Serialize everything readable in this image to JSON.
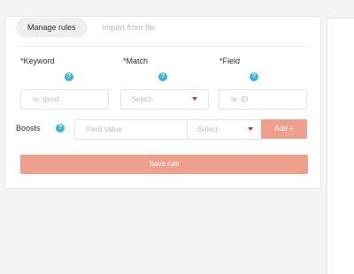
{
  "tabs": {
    "manage": "Manage rules",
    "import": "Import from file"
  },
  "fields": {
    "keyword": {
      "label": "*Keyword",
      "placeholder": "Ie: Iprod"
    },
    "match": {
      "label": "*Match",
      "select_value": "-Select-"
    },
    "field": {
      "label": "*Field",
      "placeholder": "Ie: ID"
    }
  },
  "boosts": {
    "label": "Boosts",
    "field_value_placeholder": "Field Value",
    "select_value": "-Select-",
    "add_label": "Add +"
  },
  "actions": {
    "save_label": "Save rule"
  },
  "icons": {
    "help": "?"
  },
  "colors": {
    "accent": "#eea08c",
    "help": "#3fb5d1",
    "caret": "#c0392b"
  }
}
